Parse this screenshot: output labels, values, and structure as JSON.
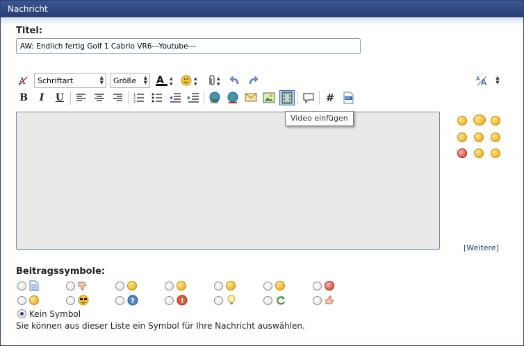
{
  "header": {
    "title": "Nachricht"
  },
  "title_section": {
    "label": "Titel:",
    "value": "AW: Endlich fertig Golf 1 Cabrio VR6---Youtube---"
  },
  "toolbar": {
    "font_select": "Schriftart",
    "size_select": "Größe",
    "bold": "B",
    "italic": "I",
    "underline": "U",
    "hash": "#"
  },
  "tooltip": "Video einfügen",
  "smilies_more": "[Weitere]",
  "post_icons": {
    "label": "Beitragssymbole:",
    "none_label": "Kein Symbol",
    "help": "Sie können aus dieser Liste ein Symbol für Ihre Nachricht auswählen."
  },
  "colors": {
    "header_bg": "#2c4076",
    "editor_bg": "#e9e9e9",
    "link": "#1c3d7a"
  }
}
